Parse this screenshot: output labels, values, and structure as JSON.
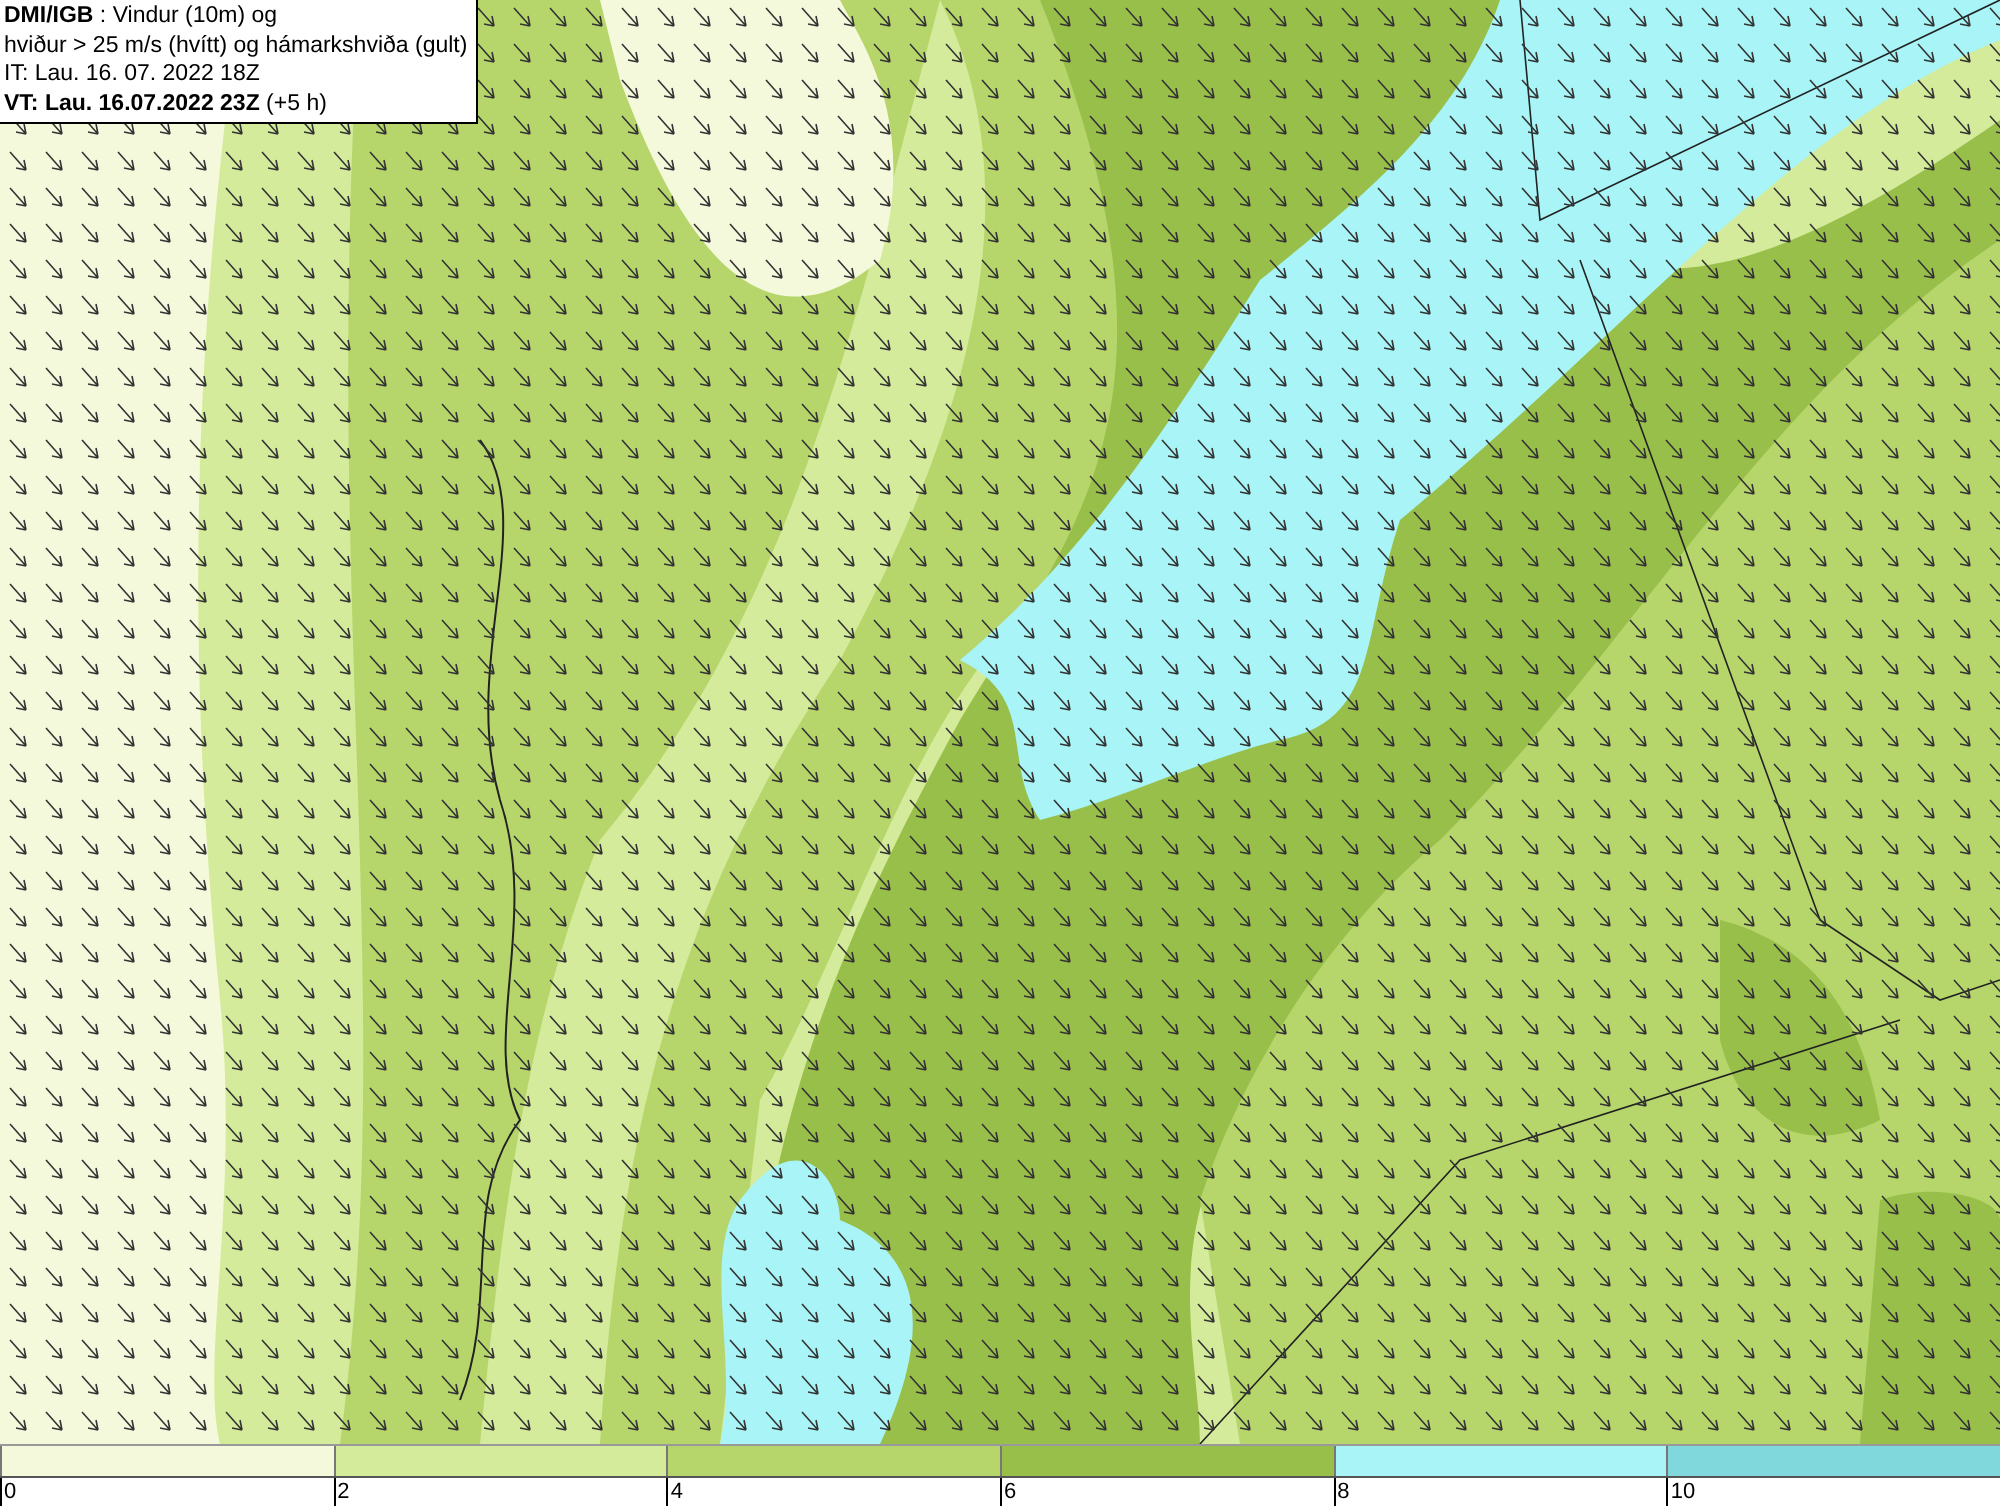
{
  "info_box": {
    "lines": [
      "**DMI/IGB** : Vindur (10m) og",
      "hviður > 25 m/s (hvítt) og hámarkshviða (gult)",
      "IT: Lau. 16. 07. 2022 18Z",
      "**VT: Lau. 16.07.2022 23Z** (+5 h)"
    ]
  },
  "colorbar": [
    {
      "label": "0",
      "color": "#f4f9dc"
    },
    {
      "label": "2",
      "color": "#d5eb9c"
    },
    {
      "label": "4",
      "color": "#b6d66c"
    },
    {
      "label": "6",
      "color": "#98bf4a"
    },
    {
      "label": "8",
      "color": "#a8f4f6"
    },
    {
      "label": "10",
      "color": "#80d8dc"
    }
  ]
}
